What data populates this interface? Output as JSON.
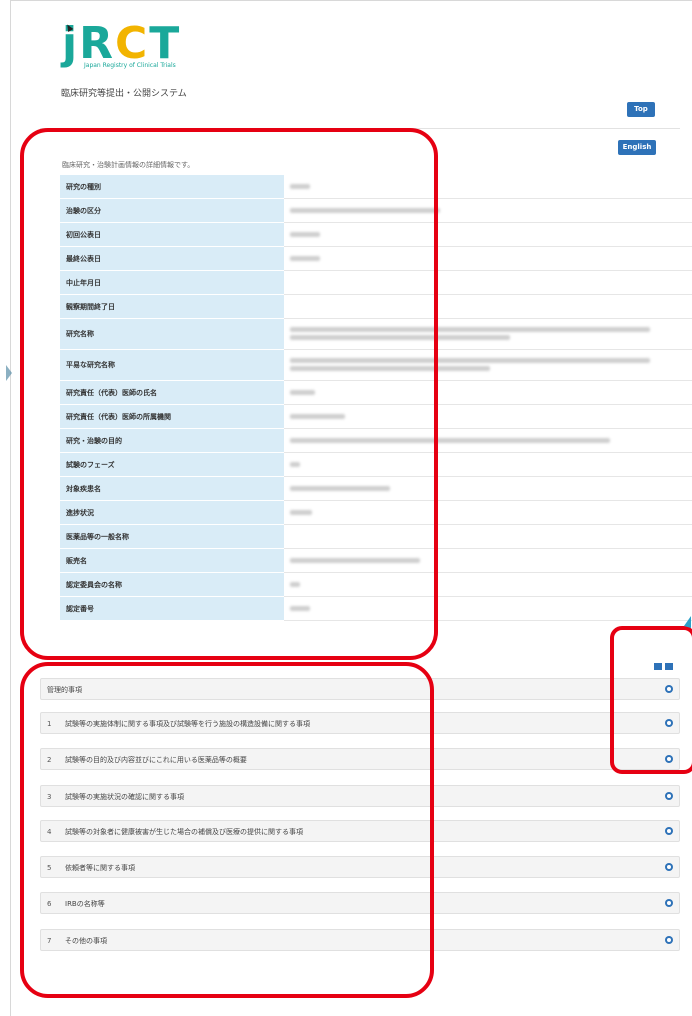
{
  "header": {
    "logo_text": "jRCT",
    "logo_subtitle": "Japan Registry of Clinical Trials",
    "system_name": "臨床研究等提出・公開システム"
  },
  "buttons": {
    "top_label": "Top",
    "english_label": "English"
  },
  "intro_text": "臨床研究・治験計画情報の詳細情報です。",
  "detail_rows": [
    {
      "label": "研究の種別"
    },
    {
      "label": "治験の区分"
    },
    {
      "label": "初回公表日"
    },
    {
      "label": "最終公表日"
    },
    {
      "label": "中止年月日"
    },
    {
      "label": "観察期間終了日"
    },
    {
      "label": "研究名称"
    },
    {
      "label": "平易な研究名称"
    },
    {
      "label": "研究責任（代表）医師の氏名"
    },
    {
      "label": "研究責任（代表）医師の所属機関"
    },
    {
      "label": "研究・治験の目的"
    },
    {
      "label": "試験のフェーズ"
    },
    {
      "label": "対象疾患名"
    },
    {
      "label": "進捗状況"
    },
    {
      "label": "医薬品等の一般名称"
    },
    {
      "label": "販売名"
    },
    {
      "label": "認定委員会の名称"
    },
    {
      "label": "認定番号"
    }
  ],
  "sections": [
    {
      "num": "",
      "label": "管理的事項"
    },
    {
      "num": "1",
      "label": "試験等の実施体制に関する事項及び試験等を行う施設の構造設備に関する事項"
    },
    {
      "num": "2",
      "label": "試験等の目的及び内容並びにこれに用いる医薬品等の概要"
    },
    {
      "num": "3",
      "label": "試験等の実施状況の確認に関する事項"
    },
    {
      "num": "4",
      "label": "試験等の対象者に健康被害が生じた場合の補償及び医療の提供に関する事項"
    },
    {
      "num": "5",
      "label": "依頼者等に関する事項"
    },
    {
      "num": "6",
      "label": "IRBの名称等"
    },
    {
      "num": "7",
      "label": "その他の事項"
    }
  ],
  "colors": {
    "brand_teal": "#1aa89a",
    "brand_yellow": "#f2b400",
    "button_blue": "#2e72b8",
    "label_bg": "#d9ecf7",
    "highlight_red": "#e60012"
  }
}
